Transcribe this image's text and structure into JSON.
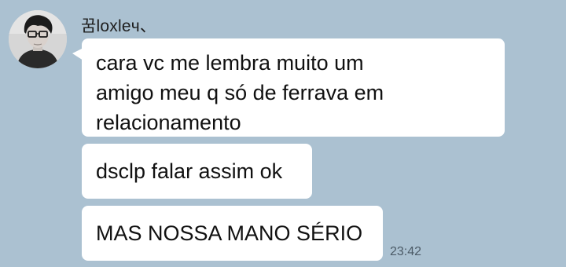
{
  "chat": {
    "sender": {
      "name": "꿈loxleч、",
      "avatar_icon": "profile-photo-icon"
    },
    "messages": [
      {
        "lines": [
          "cara vc me lembra muito um",
          "amigo meu q só de ferrava em",
          "relacionamento"
        ]
      },
      {
        "lines": [
          "dsclp falar assim ok"
        ]
      },
      {
        "lines": [
          "MAS NOSSA MANO SÉRIO"
        ],
        "time": "23:42"
      }
    ]
  },
  "colors": {
    "background": "#abc1d1",
    "bubble": "#ffffff",
    "text": "#111111",
    "timestamp": "#4b5a66"
  }
}
